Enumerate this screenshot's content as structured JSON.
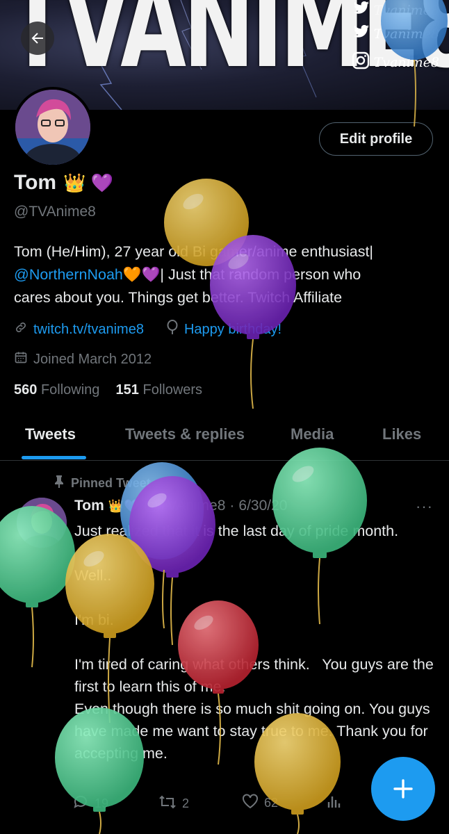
{
  "banner": {
    "title": "TVANIME8",
    "social": [
      {
        "icon": "twitter-bird-icon",
        "handle": "Tvanime8"
      },
      {
        "icon": "twitter-bird-icon",
        "handle": "Tvanime8"
      },
      {
        "icon": "instagram-icon",
        "handle": "Tvanime8"
      }
    ]
  },
  "nav": {
    "back_icon": "arrow-left-icon"
  },
  "profile": {
    "edit_label": "Edit profile",
    "name": "Tom",
    "name_emojis": "👑 💜",
    "handle": "@TVAnime8",
    "bio_line1": "Tom (He/Him), 27 year old Bi gamer/anime enthusiast|",
    "bio_mention": "@NorthernNoah",
    "bio_line2_rest": "🧡💜| Just that random person who",
    "bio_line3": "cares about you. Things get better. Twitch Affiliate",
    "website": "twitch.tv/tvanime8",
    "birthday": "Happy birthday!",
    "joined": "Joined March 2012",
    "following_count": "560",
    "following_label": "Following",
    "followers_count": "151",
    "followers_label": "Followers"
  },
  "tabs": [
    {
      "label": "Tweets",
      "active": true
    },
    {
      "label": "Tweets & replies",
      "active": false
    },
    {
      "label": "Media",
      "active": false
    },
    {
      "label": "Likes",
      "active": false
    }
  ],
  "tweet": {
    "pinned_label": "Pinned Tweet",
    "author": "Tom",
    "author_emojis": "👑💜",
    "handle": "@TVAnime8",
    "separator": "·",
    "date": "6/30/20",
    "more": "···",
    "text": "Just realized that it is the last day of pride month.\n\nWell..\n\nI'm bi.\n\nI'm tired of caring what others think.   You guys are the first to learn this of me.\nEven though there is so much shit going on. You guys have made me want to stay true to me. Thank you for accepting me.",
    "replies": "19",
    "retweets": "2",
    "likes": "62"
  },
  "fab": {
    "icon": "plus-icon"
  },
  "colors": {
    "accent": "#1d9bf0",
    "balloon_yellow": "#e8c04a",
    "balloon_purple": "#8e3fd6",
    "balloon_green": "#5fd49a",
    "balloon_blue": "#5a9fe0",
    "balloon_red": "#d9424e"
  }
}
